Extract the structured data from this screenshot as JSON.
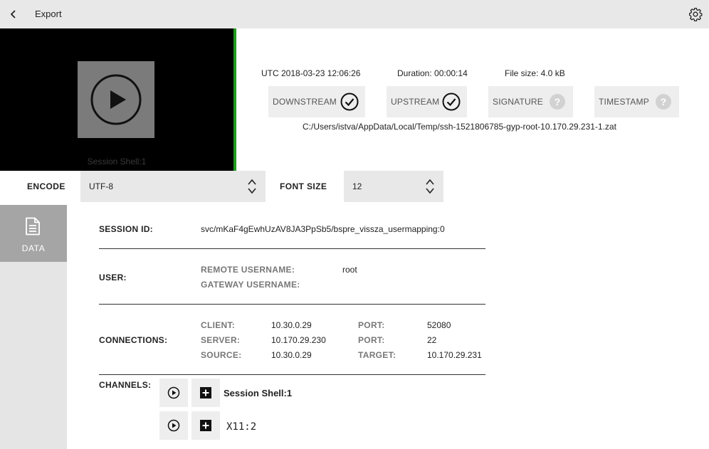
{
  "header": {
    "title": "Export",
    "back_icon": "chevron-left-icon",
    "settings_icon": "gear-icon"
  },
  "preview": {
    "channel_label": "Session Shell:1",
    "accent_color": "#1e9a1e"
  },
  "meta": {
    "utc": "UTC 2018-03-23 12:06:26",
    "duration": "Duration:  00:00:14",
    "file_size": "File size:  4.0 kB",
    "path": "C:/Users/istva/AppData/Local/Temp/ssh-1521806785-gyp-root-10.170.29.231-1.zat"
  },
  "checks": [
    {
      "label": "DOWNSTREAM",
      "state": "ok"
    },
    {
      "label": "UPSTREAM",
      "state": "ok"
    },
    {
      "label": "SIGNATURE",
      "state": "unknown"
    },
    {
      "label": "TIMESTAMP",
      "state": "unknown"
    }
  ],
  "encode": {
    "label": "ENCODE",
    "value": "UTF-8"
  },
  "font_size": {
    "label": "FONT SIZE",
    "value": "12"
  },
  "sidebar": {
    "tab_label": "DATA",
    "tab_icon": "document-icon"
  },
  "details": {
    "session_id_label": "SESSION ID:",
    "session_id": "svc/mKaF4gEwhUzAV8JA3PpSb5/bspre_vissza_usermapping:0",
    "user_label": "USER:",
    "remote_username_label": "REMOTE USERNAME:",
    "remote_username": "root",
    "gateway_username_label": "GATEWAY USERNAME:",
    "connections_label": "CONNECTIONS:",
    "client_label": "CLIENT:",
    "client": "10.30.0.29",
    "server_label": "SERVER:",
    "server": "10.170.29.230",
    "source_label": "SOURCE:",
    "source": "10.30.0.29",
    "port1_label": "PORT:",
    "port1": "52080",
    "port2_label": "PORT:",
    "port2": "22",
    "target_label": "TARGET:",
    "target": "10.170.29.231",
    "channels_label": "CHANNELS:"
  },
  "channels": [
    {
      "name": "Session Shell:1"
    },
    {
      "name": "X11:2"
    }
  ]
}
